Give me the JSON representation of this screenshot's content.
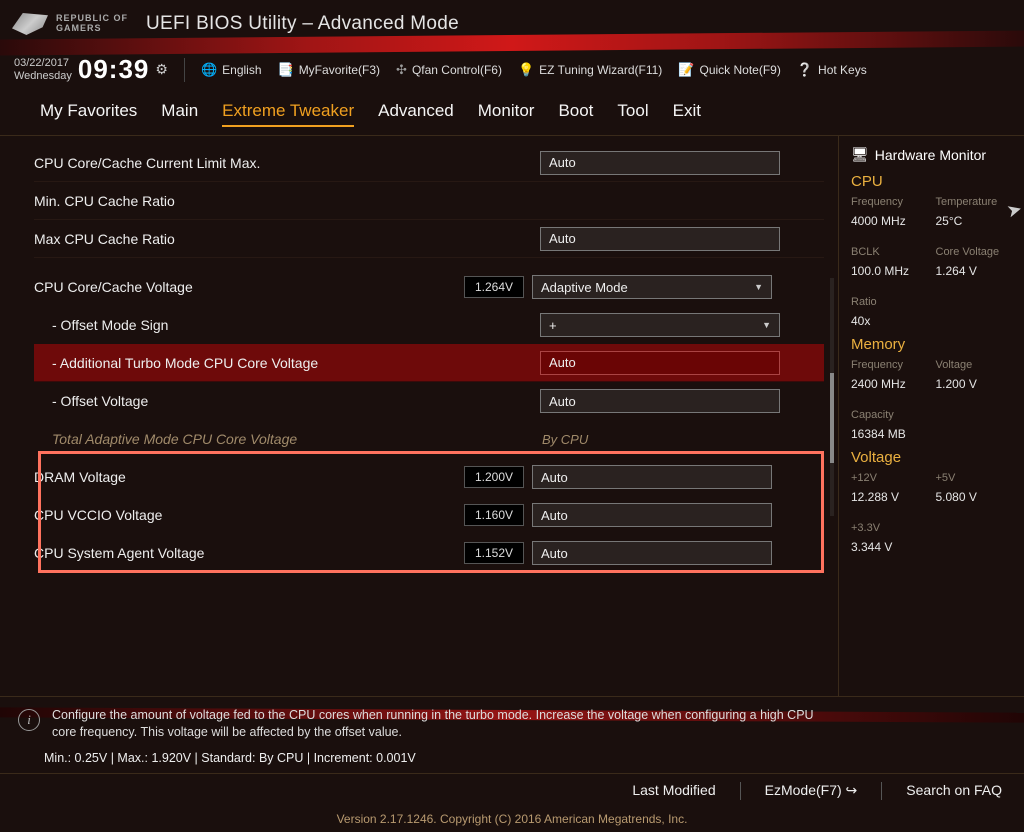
{
  "brand_line1": "REPUBLIC OF",
  "brand_line2": "GAMERS",
  "app_title": "UEFI BIOS Utility – Advanced Mode",
  "date": "03/22/2017",
  "day": "Wednesday",
  "time": "09:39",
  "topbar": {
    "language": "English",
    "favorite": "MyFavorite(F3)",
    "qfan": "Qfan Control(F6)",
    "ez": "EZ Tuning Wizard(F11)",
    "quicknote": "Quick Note(F9)",
    "hotkeys": "Hot Keys"
  },
  "tabs": [
    "My Favorites",
    "Main",
    "Extreme Tweaker",
    "Advanced",
    "Monitor",
    "Boot",
    "Tool",
    "Exit"
  ],
  "active_tab": "Extreme Tweaker",
  "settings": {
    "cpu_limit": {
      "label": "CPU Core/Cache Current Limit Max.",
      "value": "Auto"
    },
    "min_cache": {
      "label": "Min. CPU Cache Ratio",
      "value": ""
    },
    "max_cache": {
      "label": "Max CPU Cache Ratio",
      "value": "Auto"
    },
    "core_voltage": {
      "label": "CPU Core/Cache Voltage",
      "readout": "1.264V",
      "value": "Adaptive Mode"
    },
    "offset_sign": {
      "label": "- Offset Mode Sign",
      "value": "+"
    },
    "add_turbo": {
      "label": "- Additional Turbo Mode CPU Core Voltage",
      "value": "Auto"
    },
    "offset_v": {
      "label": "- Offset Voltage",
      "value": "Auto"
    },
    "total_adapt": {
      "label": "Total Adaptive Mode CPU Core Voltage",
      "value": "By CPU"
    },
    "dram": {
      "label": "DRAM Voltage",
      "readout": "1.200V",
      "value": "Auto"
    },
    "vccio": {
      "label": "CPU VCCIO Voltage",
      "readout": "1.160V",
      "value": "Auto"
    },
    "sysagent": {
      "label": "CPU System Agent Voltage",
      "readout": "1.152V",
      "value": "Auto"
    }
  },
  "help_text": "Configure the amount of voltage fed to the CPU cores when running in the turbo mode. Increase the voltage when configuring a high CPU core frequency. This voltage will be affected by the offset value.",
  "constraints": "Min.: 0.25V   |   Max.: 1.920V   |   Standard: By CPU   |   Increment: 0.001V",
  "sidebar": {
    "title": "Hardware Monitor",
    "cpu": {
      "heading": "CPU",
      "freq_l": "Frequency",
      "freq_v": "4000 MHz",
      "temp_l": "Temperature",
      "temp_v": "25°C",
      "bclk_l": "BCLK",
      "bclk_v": "100.0 MHz",
      "cv_l": "Core Voltage",
      "cv_v": "1.264 V",
      "ratio_l": "Ratio",
      "ratio_v": "40x"
    },
    "mem": {
      "heading": "Memory",
      "freq_l": "Frequency",
      "freq_v": "2400 MHz",
      "volt_l": "Voltage",
      "volt_v": "1.200 V",
      "cap_l": "Capacity",
      "cap_v": "16384 MB"
    },
    "volt": {
      "heading": "Voltage",
      "v12_l": "+12V",
      "v12_v": "12.288 V",
      "v5_l": "+5V",
      "v5_v": "5.080 V",
      "v33_l": "+3.3V",
      "v33_v": "3.344 V"
    }
  },
  "footer": {
    "last": "Last Modified",
    "ez": "EzMode(F7)",
    "faq": "Search on FAQ"
  },
  "version": "Version 2.17.1246. Copyright (C) 2016 American Megatrends, Inc."
}
